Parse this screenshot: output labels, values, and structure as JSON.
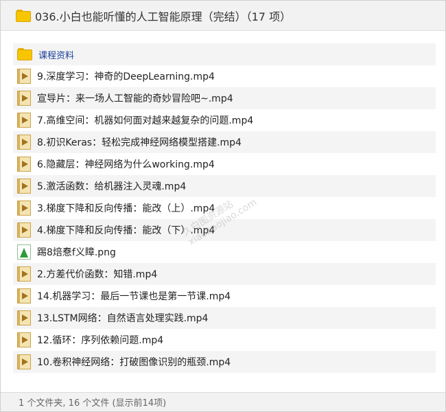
{
  "window": {
    "title": "036.小白也能听懂的人工智能原理（完结）（17 项）"
  },
  "files": [
    {
      "name": "课程资料",
      "type": "folder",
      "icon": "folder-icon"
    },
    {
      "name": "9.深度学习：神奇的DeepLearning.mp4",
      "type": "video",
      "icon": "video-file-icon"
    },
    {
      "name": "宣导片：来一场人工智能的奇妙冒险吧~.mp4",
      "type": "video",
      "icon": "video-file-icon"
    },
    {
      "name": "7.高维空间：机器如何面对越来越复杂的问题.mp4",
      "type": "video",
      "icon": "video-file-icon"
    },
    {
      "name": "8.初识Keras：轻松完成神经网络模型搭建.mp4",
      "type": "video",
      "icon": "video-file-icon"
    },
    {
      "name": "6.隐藏层：神经网络为什么working.mp4",
      "type": "video",
      "icon": "video-file-icon"
    },
    {
      "name": "5.激活函数：给机器注入灵魂.mp4",
      "type": "video",
      "icon": "video-file-icon"
    },
    {
      "name": "3.梯度下降和反向传播：能改（上）.mp4",
      "type": "video",
      "icon": "video-file-icon"
    },
    {
      "name": "4.梯度下降和反向传播：能改（下）.mp4",
      "type": "video",
      "icon": "video-file-icon"
    },
    {
      "name": "踢8焙惷f义瞕.png",
      "type": "image",
      "icon": "image-file-icon"
    },
    {
      "name": "2.方差代价函数：知错.mp4",
      "type": "video",
      "icon": "video-file-icon"
    },
    {
      "name": "14.机器学习：最后一节课也是第一节课.mp4",
      "type": "video",
      "icon": "video-file-icon"
    },
    {
      "name": "13.LSTM网络：自然语言处理实践.mp4",
      "type": "video",
      "icon": "video-file-icon"
    },
    {
      "name": "12.循环：序列依赖问题.mp4",
      "type": "video",
      "icon": "video-file-icon"
    },
    {
      "name": "10.卷积神经网络：打破图像识别的瓶颈.mp4",
      "type": "video",
      "icon": "video-file-icon"
    }
  ],
  "status": {
    "text": "1 个文件夹, 16 个文件 (显示前14项)"
  },
  "watermark": {
    "line1": "久白图资源站",
    "line2": "xiaobaojiao.com"
  },
  "colors": {
    "folder": "#f7c600",
    "folder_label": "#1a3f99",
    "row_alt": "#f4f4f4",
    "title_bar": "#f2f2f2"
  }
}
